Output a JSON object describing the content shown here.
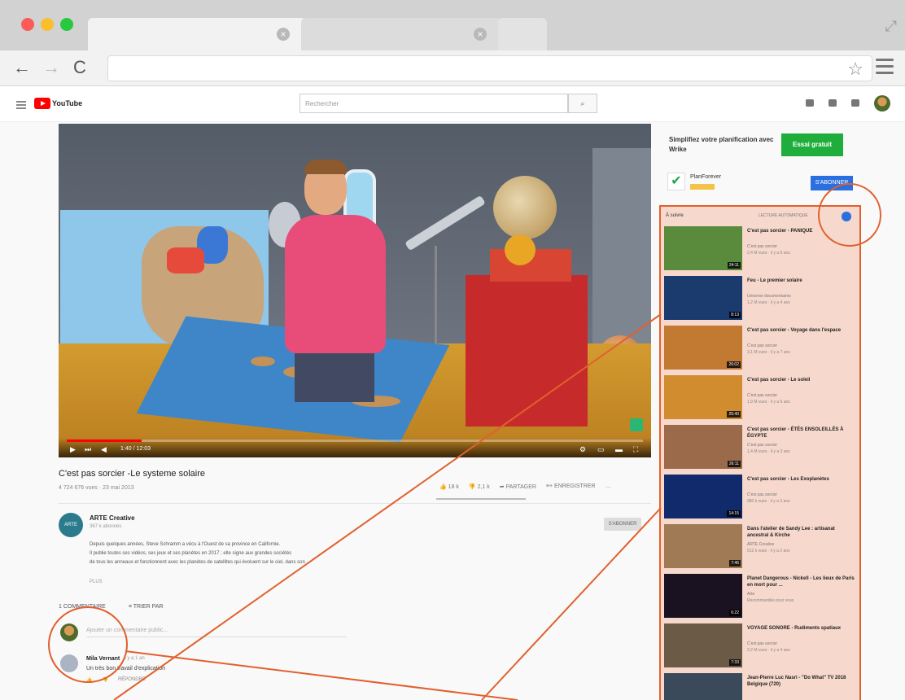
{
  "browser": {
    "tab_close_glyph": "×",
    "expand_glyph": "⤢",
    "back_glyph": "←",
    "forward_glyph": "→",
    "reload_glyph": "C",
    "star_glyph": "☆"
  },
  "youtube": {
    "logo_text": "YouTube",
    "search_placeholder": "Rechercher"
  },
  "video": {
    "time": "1:40 / 12:03",
    "progress_fraction": 0.13,
    "title": "C'est pas sorcier -Le systeme solaire",
    "meta": "4 724 676 vues · 23 mai 2013",
    "likes": "18 k",
    "dislikes": "2,1 k",
    "share": "PARTAGER",
    "save": "ENREGISTRER"
  },
  "channel": {
    "name": "ARTE Creative",
    "subs": "367 k abonnés",
    "avatar_text": "ARTE",
    "subscribe": "S'ABONNER",
    "description": [
      "Depuis quelques années, Steve Schramm a vécu à l'Ouest de sa province en Californie.",
      "Il publie toutes ses vidéos, ses jeux et ses planètes en 2017 ; elle signe aux grandes sociétés",
      "de tous les anneaux et fonctionnent avec les planètes de satellites qui évoluent sur le ciel, dans son"
    ],
    "more": "PLUS"
  },
  "comments": {
    "count_label": "1 COMMENTAIRE",
    "sort_label": "TRIER PAR",
    "add_placeholder": "Ajouter un commentaire public...",
    "author": "Mila Vernant",
    "time": "il y a 1 an",
    "text": "Un très bon travail d'explication",
    "reply": "RÉPONDRE"
  },
  "ad": {
    "title": "Simplifiez votre planification avec Wrike",
    "cta": "Essai gratuit",
    "brand": "PlanForever",
    "cta2": "S'ABONNER"
  },
  "upnext": {
    "header": "À suivre",
    "autoplay": "LECTURE AUTOMATIQUE",
    "items": [
      {
        "title": "C'est pas sorcier - PANIQUE",
        "channel": "C'est pas sorcier",
        "views": "2,4 M vues · il y a 6 ans",
        "duration": "24:11",
        "thumb": "#5a8a3c"
      },
      {
        "title": "Feu - Le premier solaire",
        "channel": "Universe documentaires",
        "views": "1,2 M vues · il y a 4 ans",
        "duration": "8:13",
        "thumb": "#1b3b6f"
      },
      {
        "title": "C'est pas sorcier - Voyage dans l'espace",
        "channel": "C'est pas sorcier",
        "views": "3,1 M vues · il y a 7 ans",
        "duration": "26:02",
        "thumb": "#c27a33"
      },
      {
        "title": "C'est pas sorcier - Le soleil",
        "channel": "C'est pas sorcier",
        "views": "1,9 M vues · il y a 5 ans",
        "duration": "25:40",
        "thumb": "#d08c2e"
      },
      {
        "title": "C'est pas sorcier - ÉTÉS ENSOLEILLÉS À ÉGYPTE",
        "channel": "C'est pas sorcier",
        "views": "1,4 M vues · il y a 3 ans",
        "duration": "26:11",
        "thumb": "#9a6a4a"
      },
      {
        "title": "C'est pas sorcier - Les Exoplanètes",
        "channel": "C'est pas sorcier",
        "views": "980 k vues · il y a 3 ans",
        "duration": "14:15",
        "thumb": "#102a6b"
      },
      {
        "title": "Dans l'atelier de Sandy Lee : artisanat ancestral & Kirche",
        "channel": "ARTE Creative",
        "views": "512 k vues · il y a 2 ans",
        "duration": "7:46",
        "thumb": "#a07a55"
      },
      {
        "title": "Planet Dangerous - Nickell - Les lieux de Paris en mort pour ...",
        "channel": "Arte",
        "views": "Recommandée pour vous",
        "duration": "6:22",
        "thumb": "#1a1220"
      },
      {
        "title": "VOYAGE SONORE - Rudiments spatiaux",
        "channel": "C'est pas sorcier",
        "views": "2,2 M vues · il y a 4 ans",
        "duration": "7:33",
        "thumb": "#6b5a46"
      },
      {
        "title": "Jean-Pierre Luc Nasri - \"Do What\" TV 2018 Belgique (720)",
        "channel": "",
        "views": "",
        "duration": "",
        "thumb": "#3a4a5a"
      }
    ]
  },
  "colors": {
    "annotation": "#e0612e",
    "highlight": "#f6d8cc",
    "yt_red": "#ff0000",
    "ad_green": "#1fae3b",
    "link_blue": "#2a6ee0"
  }
}
